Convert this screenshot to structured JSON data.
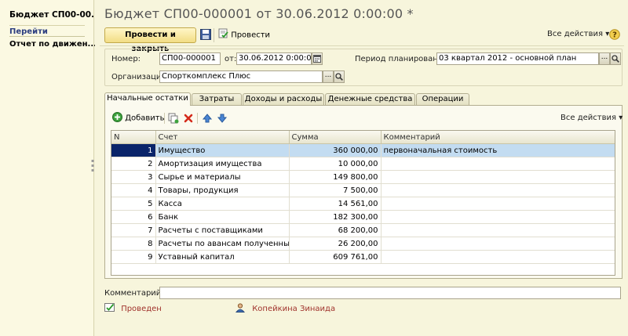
{
  "left_panel": {
    "title": "Бюджет СП00-00...",
    "go_label": "Перейти",
    "report_item": "Отчет по движен..."
  },
  "document": {
    "title": "Бюджет СП00-000001 от 30.06.2012 0:00:00 *"
  },
  "toolbar": {
    "post_close_label": "Провести и закрыть",
    "post_label": "Провести",
    "all_actions_label": "Все действия"
  },
  "header": {
    "number_label": "Номер:",
    "number_value": "СП00-000001",
    "date_label": "от:",
    "date_value": "30.06.2012  0:00:00",
    "period_label": "Период планирования:",
    "period_value": "03 квартал 2012 - основной план",
    "org_label": "Организация:",
    "org_value": "Спорткомплекс Плюс"
  },
  "tabs": [
    {
      "label": "Начальные остатки"
    },
    {
      "label": "Затраты"
    },
    {
      "label": "Доходы и расходы"
    },
    {
      "label": "Денежные средства"
    },
    {
      "label": "Операции"
    }
  ],
  "table_toolbar": {
    "add_label": "Добавить",
    "all_actions_label": "Все действия"
  },
  "table": {
    "columns": [
      "N",
      "Счет",
      "Сумма",
      "Комментарий"
    ],
    "rows": [
      {
        "n": "1",
        "account": "Имущество",
        "sum": "360 000,00",
        "comment": "первоначальная стоимость"
      },
      {
        "n": "2",
        "account": "Амортизация имущества",
        "sum": "10 000,00",
        "comment": ""
      },
      {
        "n": "3",
        "account": "Сырье и материалы",
        "sum": "149 800,00",
        "comment": ""
      },
      {
        "n": "4",
        "account": "Товары, продукция",
        "sum": "7 500,00",
        "comment": ""
      },
      {
        "n": "5",
        "account": "Касса",
        "sum": "14 561,00",
        "comment": ""
      },
      {
        "n": "6",
        "account": "Банк",
        "sum": "182 300,00",
        "comment": ""
      },
      {
        "n": "7",
        "account": "Расчеты с поставщиками",
        "sum": "68 200,00",
        "comment": ""
      },
      {
        "n": "8",
        "account": "Расчеты по авансам полученным",
        "sum": "26 200,00",
        "comment": ""
      },
      {
        "n": "9",
        "account": "Уставный капитал",
        "sum": "609 761,00",
        "comment": ""
      }
    ]
  },
  "footer": {
    "comment_label": "Комментарий:",
    "comment_value": "",
    "status_text": "Проведен",
    "author": "Копейкина Зинаида"
  },
  "colors": {
    "selected_row": "#c3dcf1",
    "status_text": "#a0322c",
    "author_text": "#a0322c",
    "selected_number_bg": "#0a246a"
  },
  "icons": {
    "save": "floppy-disk-icon",
    "post": "post-document-icon",
    "add": "green-plus-icon",
    "copy": "copy-icon",
    "delete": "red-x-icon",
    "up": "arrow-up-icon",
    "down": "arrow-down-icon",
    "calendar": "calendar-icon",
    "search": "magnifier-icon",
    "status": "posted-status-icon",
    "user": "user-icon"
  }
}
